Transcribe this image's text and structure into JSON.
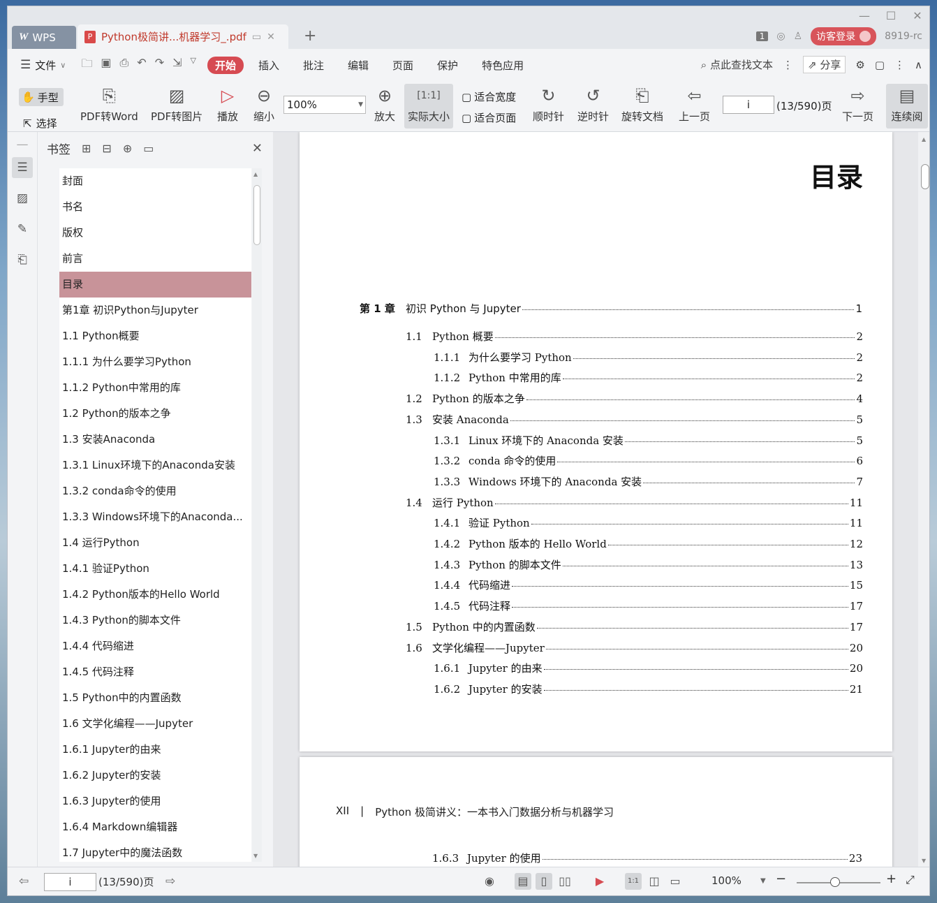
{
  "titlebar": {
    "app_tab": "WPS",
    "doc_tab_title": "Python极简讲...机器学习_.pdf",
    "badge_count": "1",
    "login_label": "访客登录",
    "user_id": "8919-rc"
  },
  "menubar": {
    "file_label": "文件",
    "tabs": [
      "开始",
      "插入",
      "批注",
      "编辑",
      "页面",
      "保护",
      "特色应用"
    ],
    "search_label": "点此查找文本",
    "share_label": "分享"
  },
  "toolbar": {
    "hand_label": "手型",
    "select_label": "选择",
    "pdf_to_word": "PDF转Word",
    "pdf_to_image": "PDF转图片",
    "play": "播放",
    "zoom_out": "缩小",
    "zoom_value": "100%",
    "zoom_in": "放大",
    "actual_size": "实际大小",
    "fit_width": "适合宽度",
    "fit_page": "适合页面",
    "rotate_cw": "顺时针",
    "rotate_ccw": "逆时针",
    "rotate_doc": "旋转文档",
    "prev_page": "上一页",
    "page_input": "i",
    "page_count": "(13/590)页",
    "next_page": "下一页",
    "continuous": "连续阅"
  },
  "bookmarks": {
    "title": "书签",
    "items": [
      "封面",
      "书名",
      "版权",
      "前言",
      "目录",
      "第1章  初识Python与Jupyter",
      "1.1  Python概要",
      "1.1.1  为什么要学习Python",
      "1.1.2  Python中常用的库",
      "1.2  Python的版本之争",
      "1.3  安装Anaconda",
      "1.3.1  Linux环境下的Anaconda安装",
      "1.3.2  conda命令的使用",
      "1.3.3  Windows环境下的Anaconda...",
      "1.4  运行Python",
      "1.4.1  验证Python",
      "1.4.2  Python版本的Hello World",
      "1.4.3  Python的脚本文件",
      "1.4.4  代码缩进",
      "1.4.5  代码注释",
      "1.5  Python中的内置函数",
      "1.6  文学化编程——Jupyter",
      "1.6.1  Jupyter的由来",
      "1.6.2  Jupyter的安装",
      "1.6.3  Jupyter的使用",
      "1.6.4  Markdown编辑器",
      "1.7  Jupyter中的魔法函数"
    ],
    "selected_index": 4
  },
  "document": {
    "toc_title": "目录",
    "chapter": {
      "num": "第 1 章",
      "text": "初识 Python 与 Jupyter",
      "page": "1"
    },
    "entries": [
      {
        "level": 1,
        "num": "1.1",
        "text": "Python 概要",
        "page": "2"
      },
      {
        "level": 2,
        "num": "1.1.1",
        "text": "为什么要学习 Python",
        "page": "2"
      },
      {
        "level": 2,
        "num": "1.1.2",
        "text": "Python 中常用的库",
        "page": "2"
      },
      {
        "level": 1,
        "num": "1.2",
        "text": "Python 的版本之争",
        "page": "4"
      },
      {
        "level": 1,
        "num": "1.3",
        "text": "安装 Anaconda",
        "page": "5"
      },
      {
        "level": 2,
        "num": "1.3.1",
        "text": "Linux 环境下的 Anaconda 安装",
        "page": "5"
      },
      {
        "level": 2,
        "num": "1.3.2",
        "text": "conda 命令的使用",
        "page": "6"
      },
      {
        "level": 2,
        "num": "1.3.3",
        "text": "Windows 环境下的 Anaconda 安装",
        "page": "7"
      },
      {
        "level": 1,
        "num": "1.4",
        "text": "运行 Python",
        "page": "11"
      },
      {
        "level": 2,
        "num": "1.4.1",
        "text": "验证 Python",
        "page": "11"
      },
      {
        "level": 2,
        "num": "1.4.2",
        "text": "Python 版本的 Hello World",
        "page": "12"
      },
      {
        "level": 2,
        "num": "1.4.3",
        "text": "Python 的脚本文件",
        "page": "13"
      },
      {
        "level": 2,
        "num": "1.4.4",
        "text": "代码缩进",
        "page": "15"
      },
      {
        "level": 2,
        "num": "1.4.5",
        "text": "代码注释",
        "page": "17"
      },
      {
        "level": 1,
        "num": "1.5",
        "text": "Python 中的内置函数",
        "page": "17"
      },
      {
        "level": 1,
        "num": "1.6",
        "text": "文学化编程——Jupyter",
        "page": "20"
      },
      {
        "level": 2,
        "num": "1.6.1",
        "text": "Jupyter 的由来",
        "page": "20"
      },
      {
        "level": 2,
        "num": "1.6.2",
        "text": "Jupyter 的安装",
        "page": "21"
      }
    ],
    "page2_running_head_num": "XII",
    "page2_separator": "|",
    "page2_running_head_title": "Python 极简讲义：一本书入门数据分析与机器学习",
    "page2_entry": {
      "num": "1.6.3",
      "text": "Jupyter 的使用",
      "page": "23"
    }
  },
  "statusbar": {
    "page_input": "i",
    "page_count": "(13/590)页",
    "zoom_value": "100%",
    "zoom_level_percent": 100
  }
}
